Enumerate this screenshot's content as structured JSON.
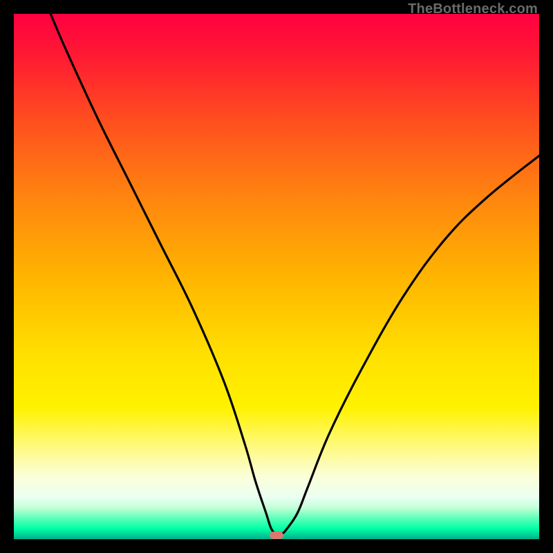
{
  "watermark": "TheBottleneck.com",
  "colors": {
    "gradient_top": "#ff0040",
    "gradient_mid": "#ffe000",
    "gradient_bottom": "#00ffa6",
    "curve_stroke": "#000000",
    "marker_fill": "#d77a6f",
    "background": "#000000"
  },
  "chart_data": {
    "type": "line",
    "title": "",
    "xlabel": "",
    "ylabel": "",
    "xlim": [
      0,
      100
    ],
    "ylim": [
      0,
      100
    ],
    "grid": false,
    "legend": false,
    "series": [
      {
        "name": "bottleneck-curve",
        "x": [
          7,
          10,
          16,
          22,
          28,
          34,
          40,
          44,
          46,
          48,
          49,
          50,
          51,
          52,
          54,
          56,
          60,
          66,
          74,
          82,
          90,
          100
        ],
        "y": [
          100,
          93,
          80,
          68,
          56,
          44,
          30,
          18,
          11,
          5,
          2,
          1,
          1,
          2,
          5,
          10,
          20,
          32,
          46,
          57,
          65,
          73
        ]
      }
    ],
    "annotations": [
      {
        "name": "min-marker",
        "x": 50,
        "y": 0.8
      }
    ],
    "ytick_colors_meaning": "green = low bottleneck, red = high"
  }
}
